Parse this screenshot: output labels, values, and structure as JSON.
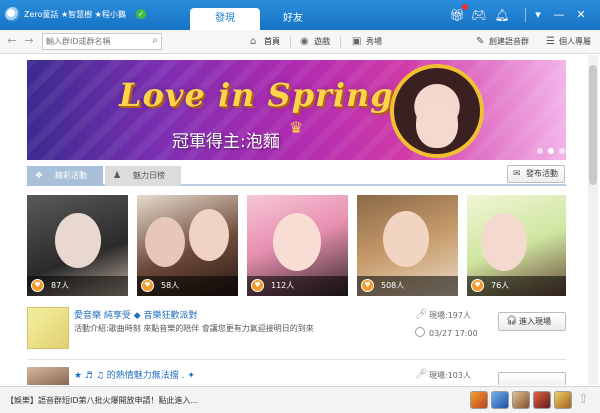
{
  "window": {
    "user_name": "Zero童話 ★智慧樹 ★程小鵝",
    "tabs": [
      "發現",
      "好友"
    ],
    "toolbar_icons": [
      "gift-icon",
      "gamepad-icon",
      "bell-icon",
      "shirt-icon"
    ],
    "window_controls": [
      "dropdown-icon",
      "minimize-icon",
      "close-icon"
    ]
  },
  "nav": {
    "search_placeholder": "輸入群ID或群名稱",
    "tabs": [
      {
        "label": "首頁",
        "icon": "home-icon"
      },
      {
        "label": "遊戲",
        "icon": "game-icon"
      },
      {
        "label": "秀場",
        "icon": "show-icon"
      }
    ],
    "right_links": [
      {
        "label": "創建語音群",
        "icon": "create-group-icon"
      },
      {
        "label": "個人專屬",
        "icon": "personal-icon"
      }
    ]
  },
  "banner": {
    "title": "Love in Spring",
    "caption": "冠軍得主:泡麵",
    "dot_count": 3,
    "active_dot": 1
  },
  "sections": {
    "tabs": [
      {
        "label": "精彩活動",
        "icon": "gift-icon"
      },
      {
        "label": "魅力日榜",
        "icon": "person-icon"
      }
    ],
    "post_button": "發布活動"
  },
  "photos": [
    {
      "count": "87人"
    },
    {
      "count": "58人"
    },
    {
      "count": "112人"
    },
    {
      "count": "508人"
    },
    {
      "count": "76人"
    }
  ],
  "rows": [
    {
      "title": "愛音樂 純享受 ◆ 音樂狂歡派對",
      "description": "活動介紹:歌曲時刻 來點音樂的陪伴 會讓您更有力氣迎接明日的到來",
      "viewers": "現場:197人",
      "time": "03/27  17:00",
      "enter_label": "進入現場"
    },
    {
      "title": "★ ♬ ♫ 的熱情魅力無法擋 .  ✦",
      "description": "",
      "viewers": "現場:103人",
      "time": "",
      "enter_label": ""
    }
  ],
  "status": {
    "text": "【娛樂】語音群短ID第八批火爆開放申請！點此進入..."
  },
  "colors": {
    "title_bar": "#1f7fd0",
    "accent": "#1f6fbf",
    "banner_title": "#ffd34a"
  }
}
